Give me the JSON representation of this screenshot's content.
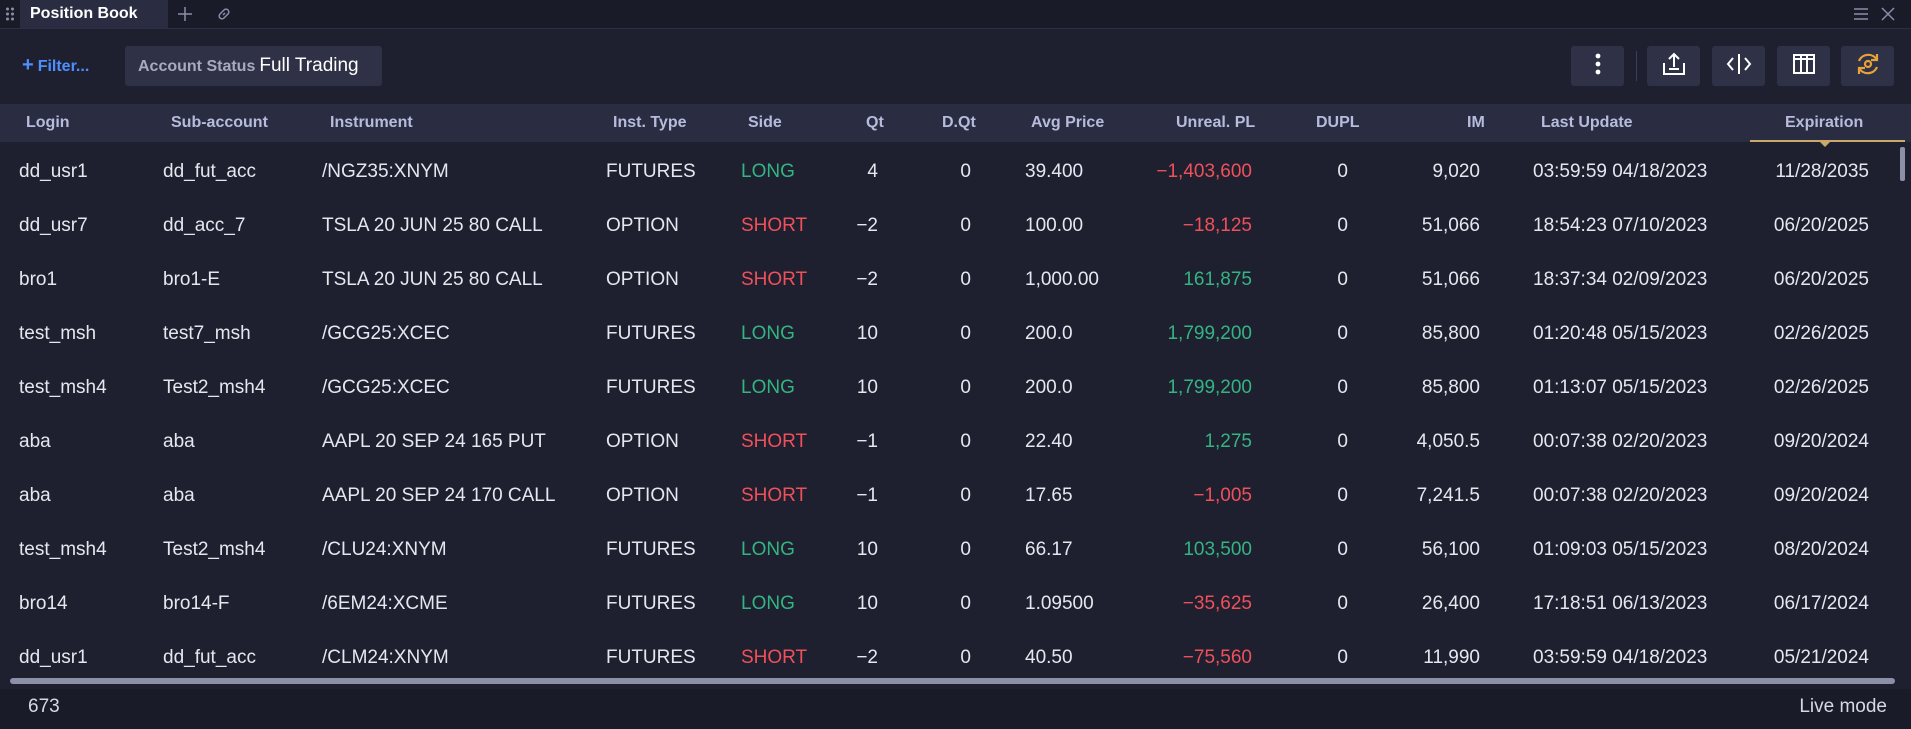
{
  "window": {
    "tab_title": "Position Book",
    "drag_icon": "drag-handle-icon",
    "add_tab_icon": "plus-icon",
    "link_icon": "link-icon",
    "menu_icon": "hamburger-menu-icon",
    "close_icon": "close-icon"
  },
  "toolbar": {
    "filter_label": "Filter...",
    "account_status_key": "Account Status",
    "account_status_value": "Full Trading",
    "buttons": [
      "more-options-icon",
      "export-icon",
      "resize-columns-icon",
      "columns-icon",
      "refresh-icon"
    ],
    "accent_color": "#e9a23b"
  },
  "table": {
    "columns": [
      "Login",
      "Sub-account",
      "Instrument",
      "Inst. Type",
      "Side",
      "Qt",
      "D.Qt",
      "Avg Price",
      "Unreal. PL",
      "DUPL",
      "IM",
      "Last Update",
      "Expiration"
    ],
    "sorted_column": "Expiration",
    "rows": [
      {
        "login": "dd_usr1",
        "sub": "dd_fut_acc",
        "instrument": "/NGZ35:XNYM",
        "type": "FUTURES",
        "side": "LONG",
        "qt": "4",
        "dqt": "0",
        "avg": "39.400",
        "pl": "−1,403,600",
        "dupl": "0",
        "im": "9,020",
        "last": "03:59:59 04/18/2023",
        "exp": "11/28/2035"
      },
      {
        "login": "dd_usr7",
        "sub": "dd_acc_7",
        "instrument": "TSLA 20 JUN 25 80 CALL",
        "type": "OPTION",
        "side": "SHORT",
        "qt": "−2",
        "dqt": "0",
        "avg": "100.00",
        "pl": "−18,125",
        "dupl": "0",
        "im": "51,066",
        "last": "18:54:23 07/10/2023",
        "exp": "06/20/2025"
      },
      {
        "login": "bro1",
        "sub": "bro1-E",
        "instrument": "TSLA 20 JUN 25 80 CALL",
        "type": "OPTION",
        "side": "SHORT",
        "qt": "−2",
        "dqt": "0",
        "avg": "1,000.00",
        "pl": "161,875",
        "dupl": "0",
        "im": "51,066",
        "last": "18:37:34 02/09/2023",
        "exp": "06/20/2025"
      },
      {
        "login": "test_msh",
        "sub": "test7_msh",
        "instrument": "/GCG25:XCEC",
        "type": "FUTURES",
        "side": "LONG",
        "qt": "10",
        "dqt": "0",
        "avg": "200.0",
        "pl": "1,799,200",
        "dupl": "0",
        "im": "85,800",
        "last": "01:20:48 05/15/2023",
        "exp": "02/26/2025"
      },
      {
        "login": "test_msh4",
        "sub": "Test2_msh4",
        "instrument": "/GCG25:XCEC",
        "type": "FUTURES",
        "side": "LONG",
        "qt": "10",
        "dqt": "0",
        "avg": "200.0",
        "pl": "1,799,200",
        "dupl": "0",
        "im": "85,800",
        "last": "01:13:07 05/15/2023",
        "exp": "02/26/2025"
      },
      {
        "login": "aba",
        "sub": "aba",
        "instrument": "AAPL 20 SEP 24 165 PUT",
        "type": "OPTION",
        "side": "SHORT",
        "qt": "−1",
        "dqt": "0",
        "avg": "22.40",
        "pl": "1,275",
        "dupl": "0",
        "im": "4,050.5",
        "last": "00:07:38 02/20/2023",
        "exp": "09/20/2024"
      },
      {
        "login": "aba",
        "sub": "aba",
        "instrument": "AAPL 20 SEP 24 170 CALL",
        "type": "OPTION",
        "side": "SHORT",
        "qt": "−1",
        "dqt": "0",
        "avg": "17.65",
        "pl": "−1,005",
        "dupl": "0",
        "im": "7,241.5",
        "last": "00:07:38 02/20/2023",
        "exp": "09/20/2024"
      },
      {
        "login": "test_msh4",
        "sub": "Test2_msh4",
        "instrument": "/CLU24:XNYM",
        "type": "FUTURES",
        "side": "LONG",
        "qt": "10",
        "dqt": "0",
        "avg": "66.17",
        "pl": "103,500",
        "dupl": "0",
        "im": "56,100",
        "last": "01:09:03 05/15/2023",
        "exp": "08/20/2024"
      },
      {
        "login": "bro14",
        "sub": "bro14-F",
        "instrument": "/6EM24:XCME",
        "type": "FUTURES",
        "side": "LONG",
        "qt": "10",
        "dqt": "0",
        "avg": "1.09500",
        "pl": "−35,625",
        "dupl": "0",
        "im": "26,400",
        "last": "17:18:51 06/13/2023",
        "exp": "06/17/2024"
      },
      {
        "login": "dd_usr1",
        "sub": "dd_fut_acc",
        "instrument": "/CLM24:XNYM",
        "type": "FUTURES",
        "side": "SHORT",
        "qt": "−2",
        "dqt": "0",
        "avg": "40.50",
        "pl": "−75,560",
        "dupl": "0",
        "im": "11,990",
        "last": "03:59:59 04/18/2023",
        "exp": "05/21/2024"
      }
    ]
  },
  "footer": {
    "count": "673",
    "mode": "Live mode"
  },
  "colors": {
    "positive": "#34b482",
    "negative": "#f0505a",
    "link": "#4e8fff",
    "sort_indicator": "#c9a86a"
  }
}
